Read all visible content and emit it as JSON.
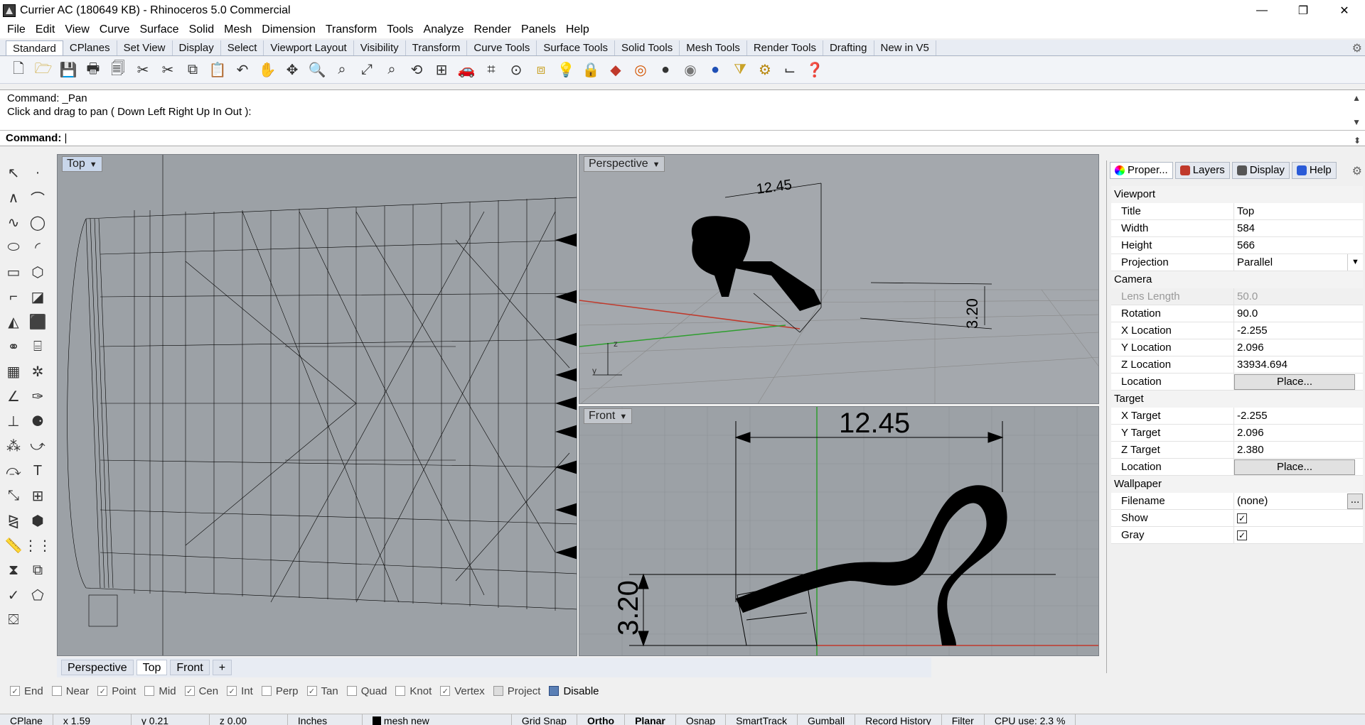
{
  "window": {
    "title": "Currier AC (180649 KB) - Rhinoceros 5.0 Commercial",
    "minimize": "—",
    "restore": "❐",
    "close": "✕"
  },
  "menu": [
    "File",
    "Edit",
    "View",
    "Curve",
    "Surface",
    "Solid",
    "Mesh",
    "Dimension",
    "Transform",
    "Tools",
    "Analyze",
    "Render",
    "Panels",
    "Help"
  ],
  "toolbar_tabs": [
    "Standard",
    "CPlanes",
    "Set View",
    "Display",
    "Select",
    "Viewport Layout",
    "Visibility",
    "Transform",
    "Curve Tools",
    "Surface Tools",
    "Solid Tools",
    "Mesh Tools",
    "Render Tools",
    "Drafting",
    "New in V5"
  ],
  "command": {
    "history_1": "Command: _Pan",
    "history_2": "Click and drag to pan ( Down  Left  Right  Up  In  Out ):",
    "prompt_label": "Command:",
    "prompt_value": "|"
  },
  "viewports": {
    "top_label": "Top",
    "perspective_label": "Perspective",
    "front_label": "Front",
    "dim_horizontal": "12.45",
    "dim_vertical": "3.20",
    "axis_z": "z",
    "axis_y": "y",
    "axis_x": "x"
  },
  "viewport_tabs": [
    "Perspective",
    "Top",
    "Front",
    "+"
  ],
  "osnap": [
    {
      "label": "End",
      "checked": true
    },
    {
      "label": "Near",
      "checked": false
    },
    {
      "label": "Point",
      "checked": true
    },
    {
      "label": "Mid",
      "checked": false
    },
    {
      "label": "Cen",
      "checked": true
    },
    {
      "label": "Int",
      "checked": true
    },
    {
      "label": "Perp",
      "checked": false
    },
    {
      "label": "Tan",
      "checked": true
    },
    {
      "label": "Quad",
      "checked": false
    },
    {
      "label": "Knot",
      "checked": false
    },
    {
      "label": "Vertex",
      "checked": true
    },
    {
      "label": "Project",
      "checked": false
    },
    {
      "label": "Disable",
      "checked": false
    }
  ],
  "status": {
    "cplane": "CPlane",
    "x": "x 1.59",
    "y": "y 0.21",
    "z": "z 0.00",
    "units": "Inches",
    "layer": "mesh new",
    "grid_snap": "Grid Snap",
    "ortho": "Ortho",
    "planar": "Planar",
    "osnap": "Osnap",
    "smarttrack": "SmartTrack",
    "gumball": "Gumball",
    "record_history": "Record History",
    "filter": "Filter",
    "cpu": "CPU use: 2.3 %"
  },
  "properties": {
    "tabs": [
      "Proper...",
      "Layers",
      "Display",
      "Help"
    ],
    "viewport_section": "Viewport",
    "title_k": "Title",
    "title_v": "Top",
    "width_k": "Width",
    "width_v": "584",
    "height_k": "Height",
    "height_v": "566",
    "projection_k": "Projection",
    "projection_v": "Parallel",
    "camera_section": "Camera",
    "lens_k": "Lens Length",
    "lens_v": "50.0",
    "rotation_k": "Rotation",
    "rotation_v": "90.0",
    "xloc_k": "X Location",
    "xloc_v": "-2.255",
    "yloc_k": "Y Location",
    "yloc_v": "2.096",
    "zloc_k": "Z Location",
    "zloc_v": "33934.694",
    "loc_k": "Location",
    "place": "Place...",
    "target_section": "Target",
    "xt_k": "X Target",
    "xt_v": "-2.255",
    "yt_k": "Y Target",
    "yt_v": "2.096",
    "zt_k": "Z Target",
    "zt_v": "2.380",
    "tloc_k": "Location",
    "wallpaper_section": "Wallpaper",
    "filename_k": "Filename",
    "filename_v": "(none)",
    "show_k": "Show",
    "gray_k": "Gray",
    "dots": "...",
    "check": "✓"
  }
}
